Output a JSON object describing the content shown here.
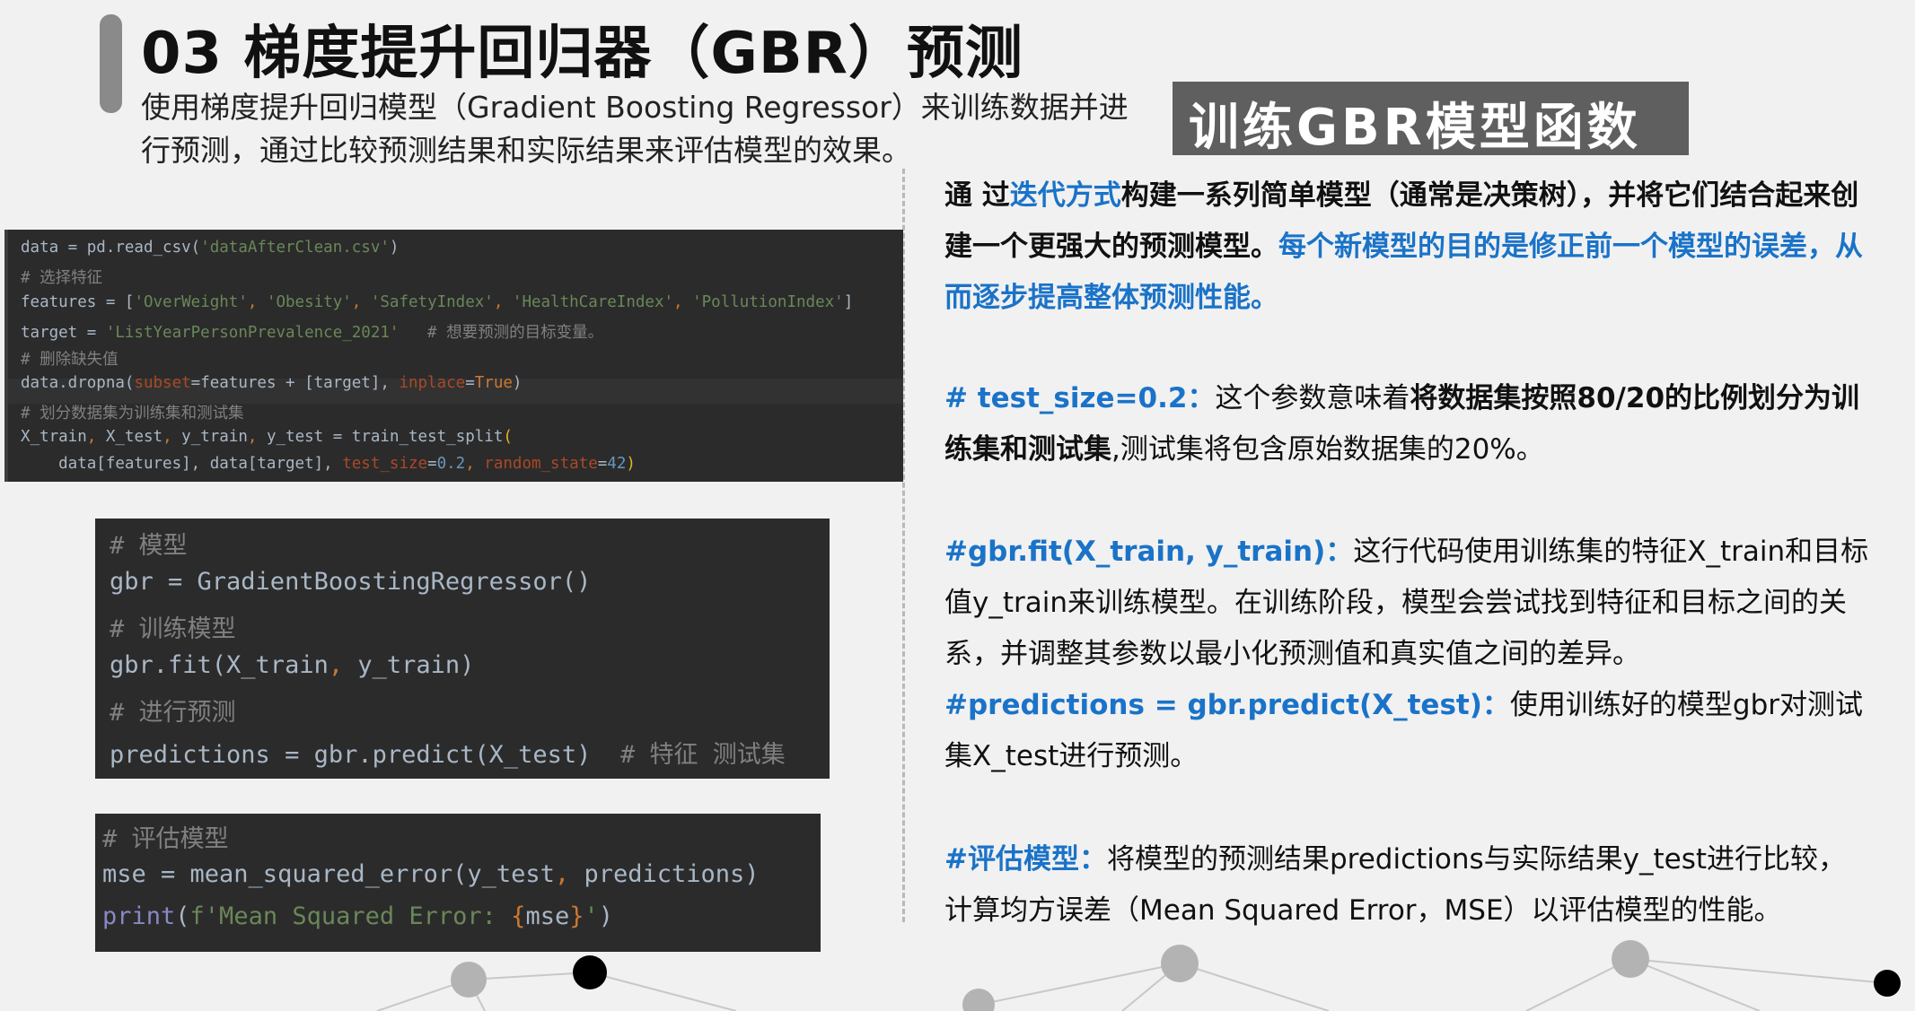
{
  "header": {
    "title": "03 梯度提升回归器（GBR）预测",
    "subtitle": "使用梯度提升回归模型（Gradient Boosting Regressor）来训练数据并进行预测，通过比较预测结果和实际结果来评估模型的效果。",
    "badge": "训练GBR模型函数"
  },
  "code_block_1": {
    "line1": [
      "data = pd.read_csv(",
      "'dataAfterClean.csv'",
      ")"
    ],
    "line2": "# 选择特征",
    "line3": [
      "features = [",
      "'OverWeight'",
      ", ",
      "'Obesity'",
      ", ",
      "'SafetyIndex'",
      ", ",
      "'HealthCareIndex'",
      ", ",
      "'PollutionIndex'",
      "]"
    ],
    "line4": [
      "target = ",
      "'ListYearPersonPrevalence_2021'",
      "   # 想要预测的目标变量。"
    ],
    "line5": "# 删除缺失值",
    "line6": [
      "data.dropna(",
      "subset",
      "=features + [target], ",
      "inplace",
      "=",
      "True",
      ")"
    ],
    "line7": "# 划分数据集为训练集和测试集",
    "line8": [
      "X_train",
      ", ",
      "X_test",
      ", ",
      "y_train",
      ", ",
      "y_test = train_test_split",
      "("
    ],
    "line9": [
      "    data[features], data[target], ",
      "test_size",
      "=",
      "0.2",
      ", ",
      "random_state",
      "=",
      "42",
      ")"
    ]
  },
  "code_block_2": {
    "line1": "# 模型",
    "line2": "gbr = GradientBoostingRegressor()",
    "line3": "# 训练模型",
    "line4": [
      "gbr.fit(X_train",
      ", ",
      "y_train)"
    ],
    "line5": "# 进行预测",
    "line6": [
      "predictions = gbr.predict(X_test)  ",
      "# 特征 测试集"
    ]
  },
  "code_block_3": {
    "line1": "# 评估模型",
    "line2": [
      "mse = mean_squared_error(y_test",
      ", ",
      "predictions)"
    ],
    "line3": [
      "print",
      "(",
      "f'Mean Squared Error: ",
      "{",
      "mse",
      "}",
      "'",
      ")"
    ]
  },
  "explanations": {
    "p1": {
      "a": "通  过",
      "b": "迭代方式",
      "c": "构建一系列简单模型（通常是决策树），并将它们结合起来创建一个更强大的预测模型。",
      "d": "每个新模型的目的是修正前一个模型的误差，从而逐步提高整体预测性能。"
    },
    "p2": {
      "a": "# test_size=0.2：",
      "b": "这个参数意味着",
      "c": "将数据集按照80/20的比例划分为训练集和测试集",
      "d": ",测试集将包含原始数据集的20%。"
    },
    "p3": {
      "a": "#gbr.fit(X_train, y_train)：",
      "b": "这行代码使用训练集的特征X_train和目标值y_train来训练模型。在训练阶段，模型会尝试找到特征和目标之间的关系，并调整其参数以最小化预测值和真实值之间的差异。"
    },
    "p4": {
      "a": "#predictions = gbr.predict(X_test)：",
      "b": "使用训练好的模型gbr对测试集X_test进行预测。"
    },
    "p5": {
      "a": "#评估模型：",
      "b": "将模型的预测结果predictions与实际结果y_test进行比较，计算均方误差（Mean Squared Error，MSE）以评估模型的性能。"
    }
  },
  "colors": {
    "accent_blue": "#1a73c8",
    "badge_gray": "#5f5f5f",
    "code_bg": "#2b2b2b"
  }
}
